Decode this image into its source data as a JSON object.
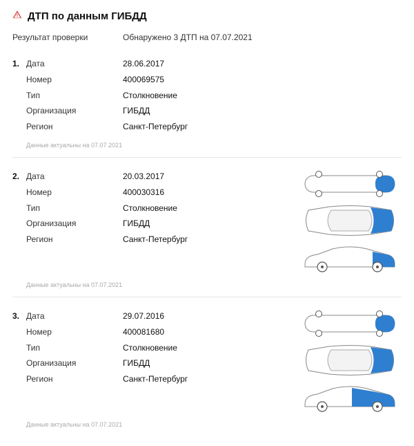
{
  "header": {
    "title": "ДТП по данным ГИБДД",
    "result_label": "Результат проверки",
    "result_value": "Обнаружено 3 ДТП на 07.07.2021"
  },
  "labels": {
    "date": "Дата",
    "number": "Номер",
    "type": "Тип",
    "org": "Организация",
    "region": "Регион",
    "actual_prefix": "Данные актуальны на "
  },
  "actual_date": "07.07.2021",
  "records": [
    {
      "idx": "1.",
      "date": "28.06.2017",
      "number": "400069575",
      "type": "Столкновение",
      "org": "ГИБДД",
      "region": "Санкт-Петербург",
      "has_diagram": false
    },
    {
      "idx": "2.",
      "date": "20.03.2017",
      "number": "400030316",
      "type": "Столкновение",
      "org": "ГИБДД",
      "region": "Санкт-Петербург",
      "has_diagram": true,
      "damage": "rear"
    },
    {
      "idx": "3.",
      "date": "29.07.2016",
      "number": "400081680",
      "type": "Столкновение",
      "org": "ГИБДД",
      "region": "Санкт-Петербург",
      "has_diagram": true,
      "damage": "rear-door"
    }
  ]
}
